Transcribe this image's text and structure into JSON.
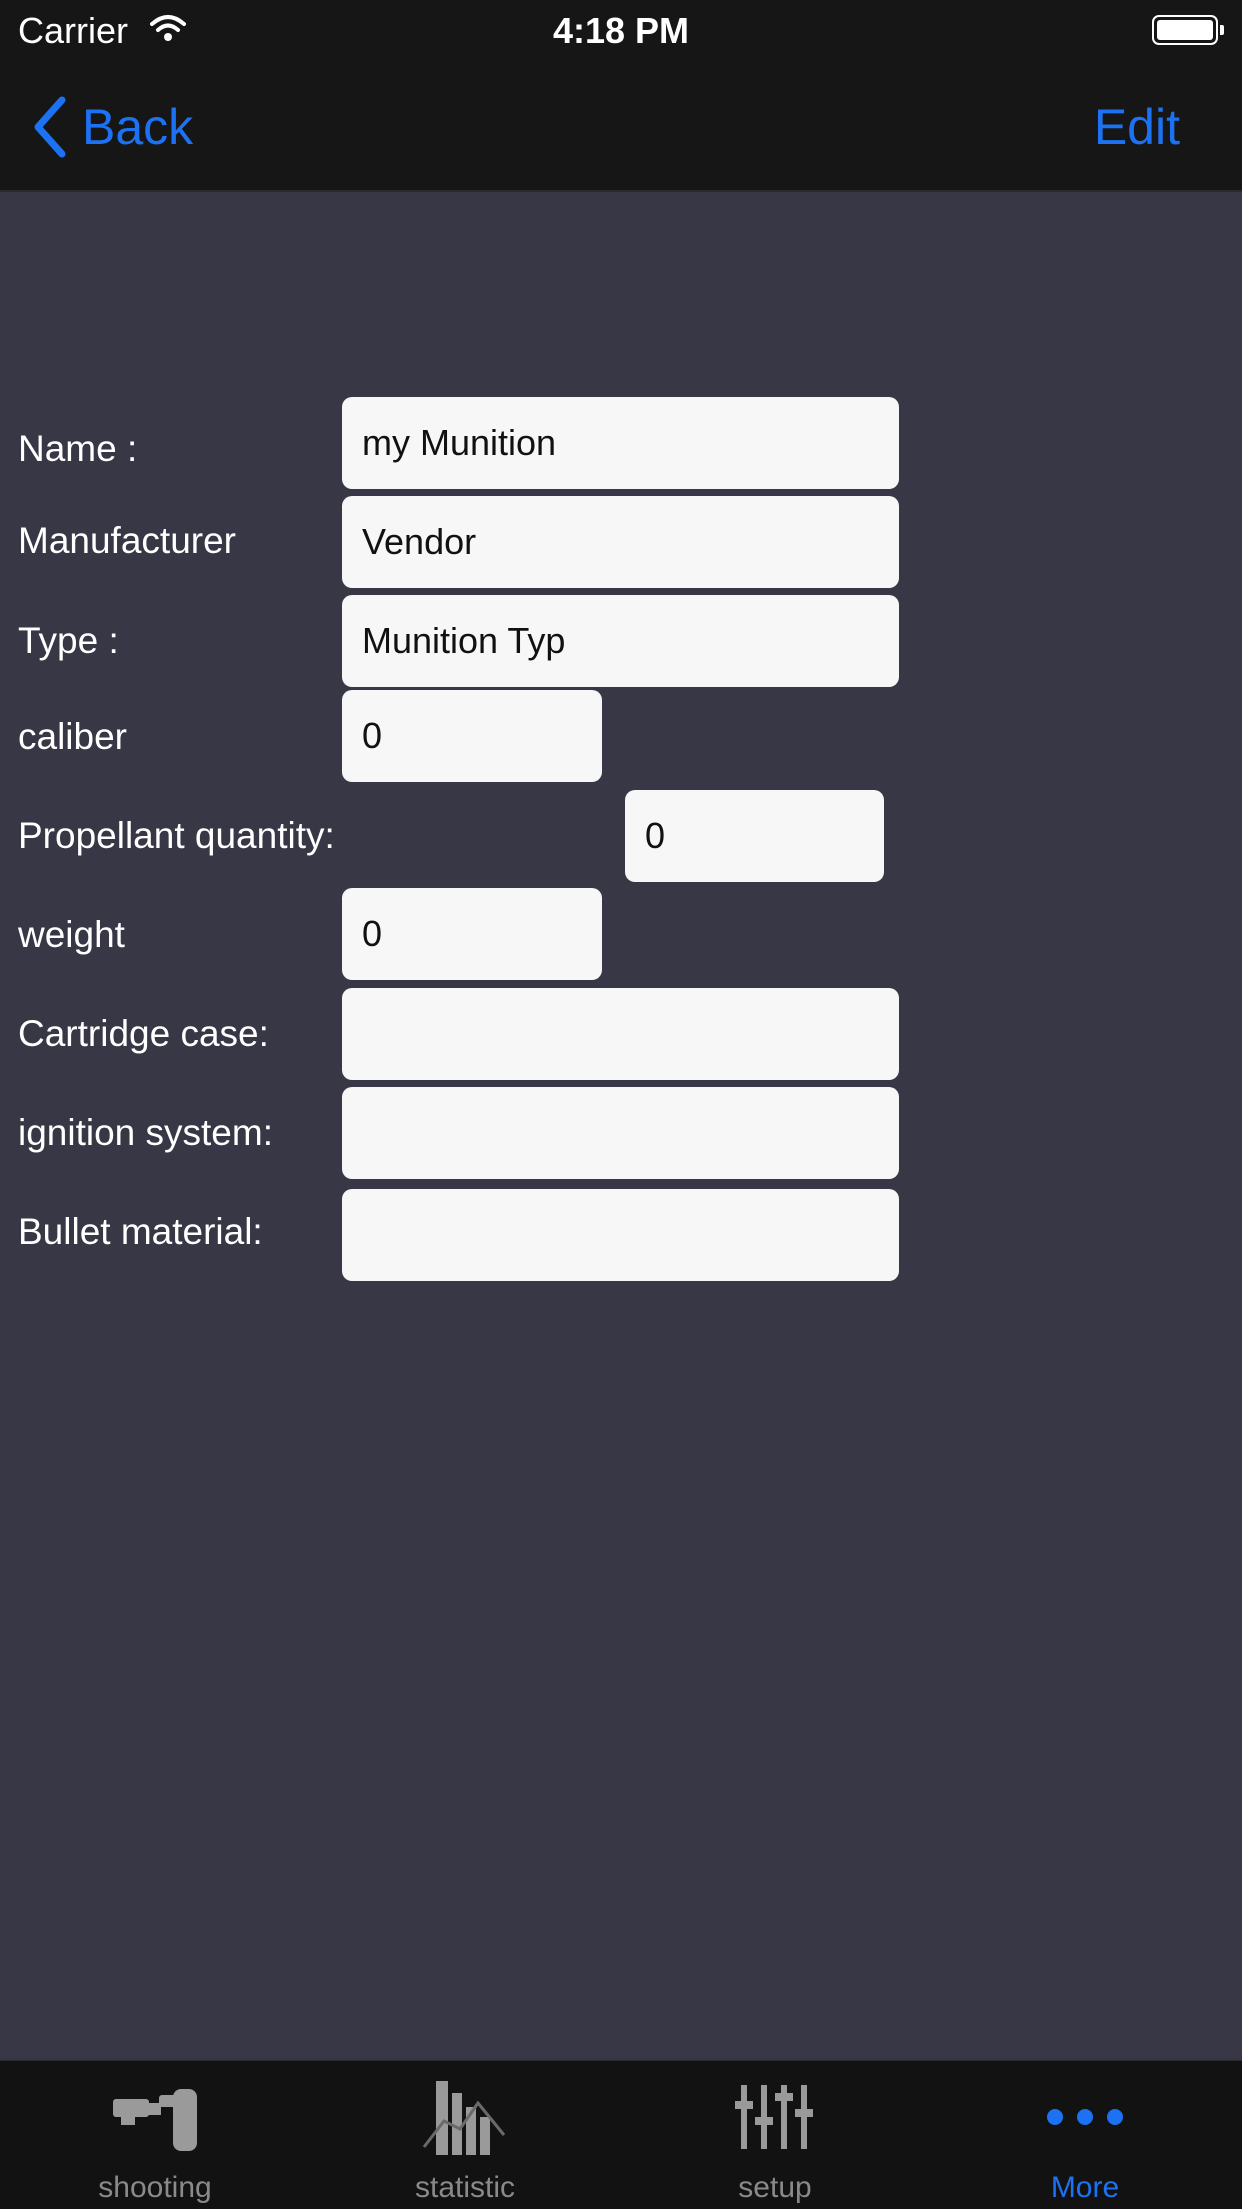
{
  "status_bar": {
    "carrier": "Carrier",
    "time": "4:18 PM"
  },
  "nav": {
    "back_label": "Back",
    "edit_label": "Edit"
  },
  "form": {
    "name_label": "Name :",
    "name_value": "my Munition",
    "manufacturer_label": "Manufacturer",
    "manufacturer_value": "Vendor",
    "type_label": "Type :",
    "type_value": "Munition Typ",
    "caliber_label": "caliber",
    "caliber_value": "0",
    "propellant_label": "Propellant quantity:",
    "propellant_value": "0",
    "weight_label": "weight",
    "weight_value": "0",
    "cartridge_label": "Cartridge case:",
    "cartridge_value": "",
    "ignition_label": "ignition system:",
    "ignition_value": "",
    "bullet_label": "Bullet material:",
    "bullet_value": ""
  },
  "tabs": [
    {
      "label": "shooting",
      "icon": "pistol-icon"
    },
    {
      "label": "statistic",
      "icon": "chart-icon"
    },
    {
      "label": "setup",
      "icon": "sliders-icon"
    },
    {
      "label": "More",
      "icon": "more-icon",
      "active": true
    }
  ],
  "colors": {
    "accent": "#1c72f2",
    "background": "#383746",
    "bar": "#161616"
  }
}
